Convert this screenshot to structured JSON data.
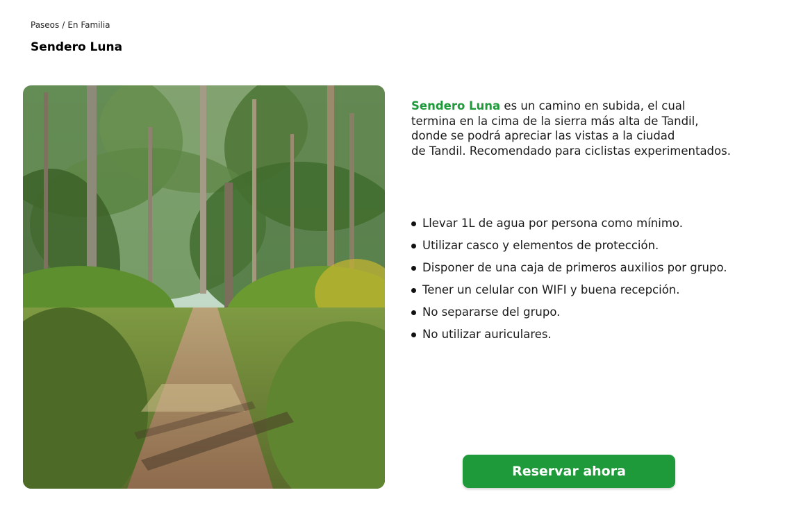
{
  "breadcrumb": {
    "parent": "Paseos",
    "separator": "/",
    "current": "En Familia"
  },
  "page_title": "Sendero Luna",
  "intro": {
    "highlight": "Sendero Luna",
    "line1": " es un camino en subida, el cual",
    "line2": "termina en la cima de la sierra más alta de Tandil,",
    "line3": "donde se podrá apreciar las vistas a la ciudad",
    "line4": "de Tandil. Recomendado para ciclistas experimentados."
  },
  "tips": [
    "Llevar 1L de agua por persona como mínimo.",
    "Utilizar casco y elementos de protección.",
    "Disponer de una caja de primeros auxilios por grupo.",
    "Tener un celular con WIFI y buena recepción.",
    "No separarse del grupo.",
    "No utilizar auriculares."
  ],
  "cta": {
    "label": "Reservar ahora"
  },
  "colors": {
    "accent": "#1e9a3a",
    "text": "#1a1a1a"
  },
  "image": {
    "subject": "forest-trail-photo"
  }
}
